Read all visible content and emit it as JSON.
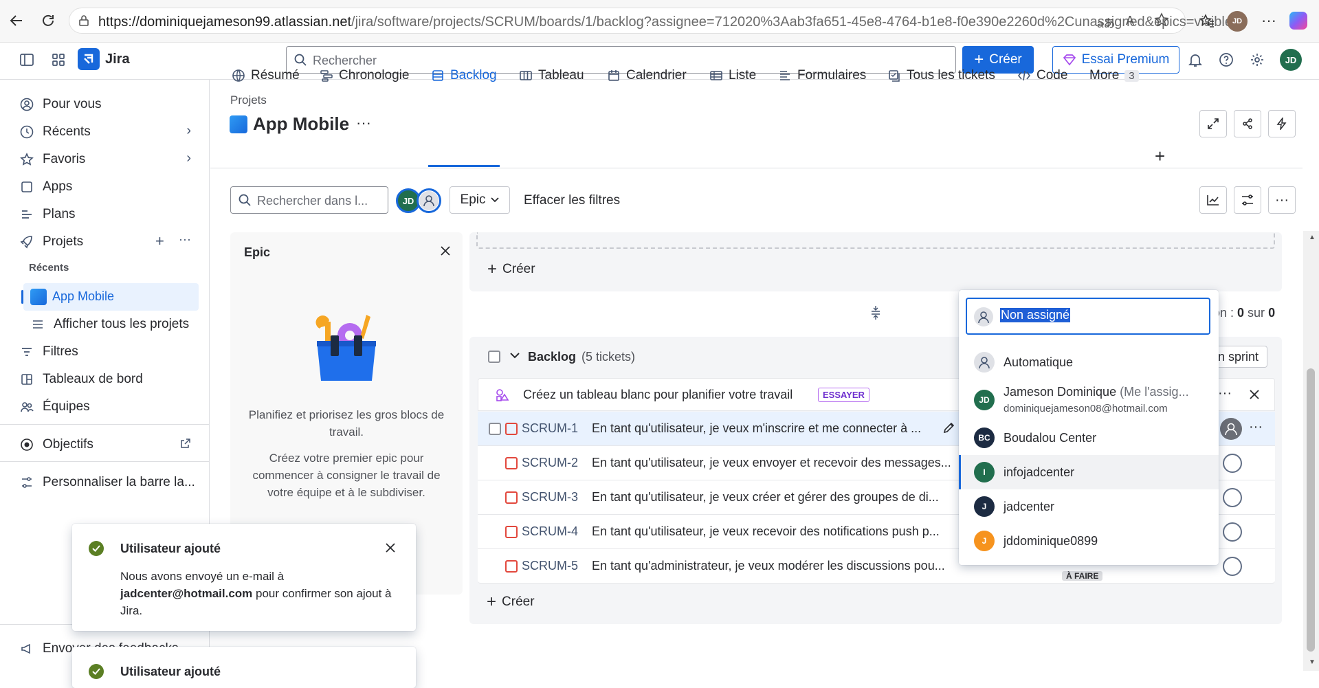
{
  "browser": {
    "url_host": "https://dominiquejameson99.atlassian.net",
    "url_path": "/jira/software/projects/SCRUM/boards/1/backlog?assignee=712020%3Aab3fa651-45e8-4764-b1e8-f0e390e2260d%2Cunassigned&epics=visible",
    "tab_avatar_initials": "JD"
  },
  "topnav": {
    "app_name": "Jira",
    "search_placeholder": "Rechercher",
    "create_label": "Créer",
    "premium_label": "Essai Premium",
    "user_initials": "JD"
  },
  "sidebar": {
    "items": [
      {
        "label": "Pour vous"
      },
      {
        "label": "Récents"
      },
      {
        "label": "Favoris"
      },
      {
        "label": "Apps"
      },
      {
        "label": "Plans"
      },
      {
        "label": "Projets"
      }
    ],
    "recents_header": "Récents",
    "project_item": "App Mobile",
    "view_all_projects": "Afficher tous les projets",
    "filters": "Filtres",
    "dashboards": "Tableaux de bord",
    "teams": "Équipes",
    "goals": "Objectifs",
    "customize": "Personnaliser la barre la...",
    "feedback": "Envoyer des feedbacks"
  },
  "header": {
    "breadcrumb": "Projets",
    "project_title": "App Mobile",
    "more_dots": "···"
  },
  "tabs": [
    {
      "label": "Résumé"
    },
    {
      "label": "Chronologie"
    },
    {
      "label": "Backlog"
    },
    {
      "label": "Tableau"
    },
    {
      "label": "Calendrier"
    },
    {
      "label": "Liste"
    },
    {
      "label": "Formulaires"
    },
    {
      "label": "Tous les tickets"
    },
    {
      "label": "Code"
    },
    {
      "label": "More"
    }
  ],
  "more_count": "3",
  "filters": {
    "search_placeholder": "Rechercher dans l...",
    "avatar_initials": "JD",
    "epic_label": "Epic",
    "clear_label": "Effacer les filtres"
  },
  "epic_panel": {
    "title": "Epic",
    "text1": "Planifiez et priorisez les gros blocs de travail.",
    "text2": "Créez votre premier epic pour commencer à consigner le travail de votre équipe et à le subdiviser."
  },
  "sprint": {
    "create_label": "Créer",
    "estimation_prefix": "on : ",
    "estimation_value": "0",
    "estimation_sep": " sur ",
    "estimation_total": "0"
  },
  "backlog": {
    "title": "Backlog",
    "count": "(5 tickets)",
    "create_sprint": "n sprint",
    "banner_text": "Créez un tableau blanc pour planifier votre travail",
    "banner_badge": "ESSAYER",
    "create_label": "Créer",
    "status_label": "À FAIRE",
    "rows": [
      {
        "key": "SCRUM-1",
        "summary": "En tant qu'utilisateur, je veux m'inscrire et me connecter à ..."
      },
      {
        "key": "SCRUM-2",
        "summary": "En tant qu'utilisateur, je veux envoyer et recevoir des messages..."
      },
      {
        "key": "SCRUM-3",
        "summary": "En tant qu'utilisateur, je veux créer et gérer des groupes de di..."
      },
      {
        "key": "SCRUM-4",
        "summary": "En tant qu'utilisateur, je veux recevoir des notifications push p..."
      },
      {
        "key": "SCRUM-5",
        "summary": "En tant qu'administrateur, je veux modérer les discussions pou..."
      }
    ]
  },
  "assignee_dropdown": {
    "input_value": "Non assigné",
    "options": [
      {
        "name": "Automatique",
        "initials": "",
        "color": "#dfe1e6"
      },
      {
        "name": "Jameson Dominique",
        "suffix": "(Me l'assig...",
        "email": "dominiquejameson08@hotmail.com",
        "initials": "JD",
        "color": "#216e4e"
      },
      {
        "name": "Boudalou Center",
        "initials": "BC",
        "color": "#1c2b42"
      },
      {
        "name": "infojadcenter",
        "initials": "I",
        "color": "#216e4e"
      },
      {
        "name": "jadcenter",
        "initials": "J",
        "color": "#1c2b42"
      },
      {
        "name": "jddominique0899",
        "initials": "J",
        "color": "#f6931e"
      }
    ]
  },
  "toasts": [
    {
      "title": "Utilisateur ajouté",
      "body_pre": "Nous avons envoyé un e-mail à ",
      "email": "jadcenter@hotmail.com",
      "body_post": " pour confirmer son ajout à Jira."
    },
    {
      "title": "Utilisateur ajouté"
    }
  ],
  "colors": {
    "accent": "#1868db",
    "success": "#5b7f24",
    "bug": "#e2483d"
  }
}
